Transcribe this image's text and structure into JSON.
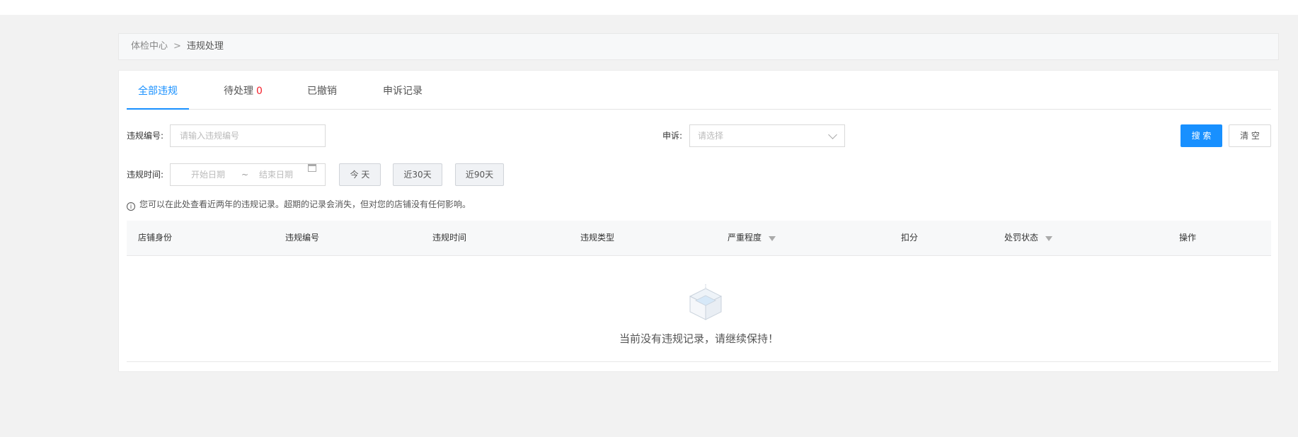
{
  "breadcrumb": {
    "root": "体检中心",
    "separator": ">",
    "current": "违规处理"
  },
  "tabs": [
    {
      "label": "全部违规",
      "active": true
    },
    {
      "label": "待处理",
      "count": "0"
    },
    {
      "label": "已撤销"
    },
    {
      "label": "申诉记录"
    }
  ],
  "filters": {
    "violation_no_label": "违规编号:",
    "violation_no_placeholder": "请输入违规编号",
    "appeal_label": "申诉:",
    "appeal_placeholder": "请选择",
    "time_label": "违规时间:",
    "start_placeholder": "开始日期",
    "range_separator": "~",
    "end_placeholder": "结束日期",
    "quick_today": "今 天",
    "quick_30": "近30天",
    "quick_90": "近90天"
  },
  "actions": {
    "search": "搜 索",
    "clear": "清 空"
  },
  "tip": "您可以在此处查看近两年的违规记录。超期的记录会消失，但对您的店铺没有任何影响。",
  "table": {
    "columns": [
      "店铺身份",
      "违规编号",
      "违规时间",
      "违规类型",
      "严重程度",
      "扣分",
      "处罚状态",
      "操作"
    ],
    "rows": []
  },
  "empty_text": "当前没有违规记录，请继续保持！",
  "colors": {
    "accent": "#1890ff",
    "count_red": "#f5222d"
  }
}
